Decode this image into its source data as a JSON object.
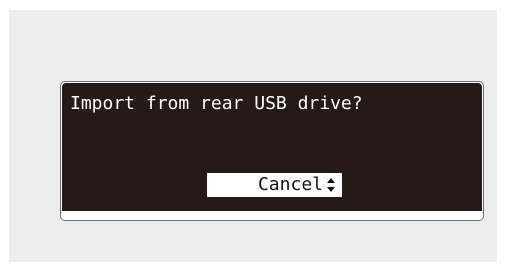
{
  "dialog": {
    "message": "Import from rear USB drive?",
    "selection": {
      "label": "Cancel",
      "icon": "up-down-arrows-icon"
    }
  },
  "colors": {
    "screen_background": "#251a18",
    "screen_text": "#ffffff",
    "selection_background": "#ffffff",
    "selection_text": "#111111",
    "panel_background": "#ededed"
  }
}
